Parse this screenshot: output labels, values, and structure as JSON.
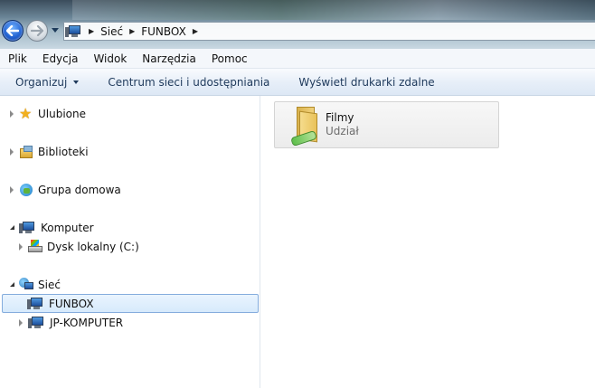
{
  "address": {
    "crumbs": [
      "Sieć",
      "FUNBOX"
    ]
  },
  "menu": [
    "Plik",
    "Edycja",
    "Widok",
    "Narzędzia",
    "Pomoc"
  ],
  "commands": {
    "organize": "Organizuj",
    "network_center": "Centrum sieci i udostępniania",
    "remote_printers": "Wyświetl drukarki zdalne"
  },
  "tree": {
    "favorites": "Ulubione",
    "libraries": "Biblioteki",
    "homegroup": "Grupa domowa",
    "computer": "Komputer",
    "local_disk": "Dysk lokalny (C:)",
    "network": "Sieć",
    "funbox": "FUNBOX",
    "jp_computer": "JP-KOMPUTER"
  },
  "content": {
    "items": [
      {
        "name": "Filmy",
        "type": "Udział"
      }
    ]
  },
  "colors": {
    "selection_border": "#84acdd",
    "command_text": "#1e395b"
  }
}
